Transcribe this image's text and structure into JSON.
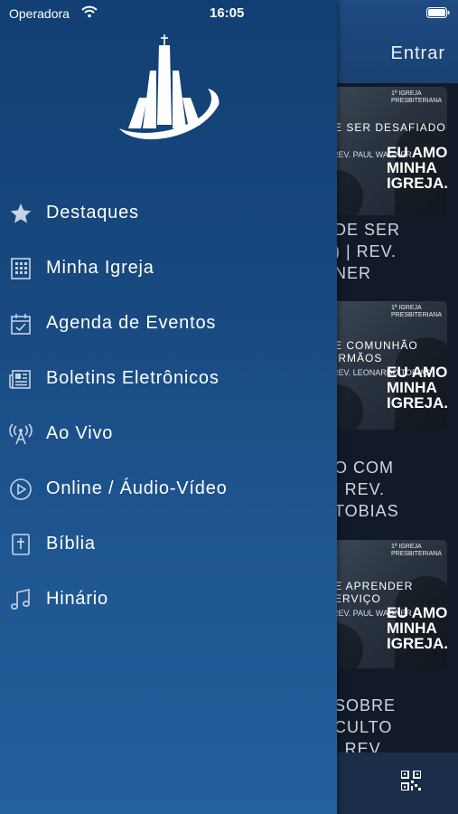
{
  "status_bar": {
    "carrier": "Operadora",
    "time": "16:05"
  },
  "header": {
    "login_label": "Entrar"
  },
  "background_cards": [
    {
      "title_lines": [
        "E SER DESAFIADO"
      ],
      "subtitle": "REV. PAUL WAGNER",
      "amo_lines": [
        "EU AMO",
        "MINHA",
        "IGREJA."
      ],
      "brand_lines": [
        "1ª IGREJA",
        "PRESBITERIANA"
      ]
    },
    {
      "title_lines": [
        "E COMUNHÃO",
        "IRMÃOS"
      ],
      "subtitle": "REV. LEONARDO TOBIAS",
      "amo_lines": [
        "EU AMO",
        "MINHA",
        "IGREJA."
      ],
      "brand_lines": [
        "1ª IGREJA",
        "PRESBITERIANA"
      ]
    },
    {
      "title_lines": [
        "E APRENDER",
        "ERVIÇO"
      ],
      "subtitle": "REV. PAUL WAGNER",
      "amo_lines": [
        "EU AMO",
        "MINHA",
        "IGREJA."
      ],
      "brand_lines": [
        "1ª IGREJA",
        "PRESBITERIANA"
      ]
    }
  ],
  "background_texts": [
    "DE SER\n) | REV.\nNER",
    "O COM\n| REV.\nTOBIAS",
    "SOBRE\nCULTO\n| REV."
  ],
  "menu": {
    "items": [
      {
        "label": "Destaques",
        "icon": "star-icon"
      },
      {
        "label": "Minha Igreja",
        "icon": "building-icon"
      },
      {
        "label": "Agenda de Eventos",
        "icon": "calendar-icon"
      },
      {
        "label": "Boletins Eletrônicos",
        "icon": "newspaper-icon"
      },
      {
        "label": "Ao Vivo",
        "icon": "broadcast-icon"
      },
      {
        "label": "Online / Áudio-Vídeo",
        "icon": "play-circle-icon"
      },
      {
        "label": "Bíblia",
        "icon": "bible-icon"
      },
      {
        "label": "Hinário",
        "icon": "music-note-icon"
      }
    ]
  },
  "colors": {
    "drawer_top": "#123f73",
    "drawer_bottom": "#24609c",
    "header": "#1f4b82",
    "background": "#111a26"
  }
}
